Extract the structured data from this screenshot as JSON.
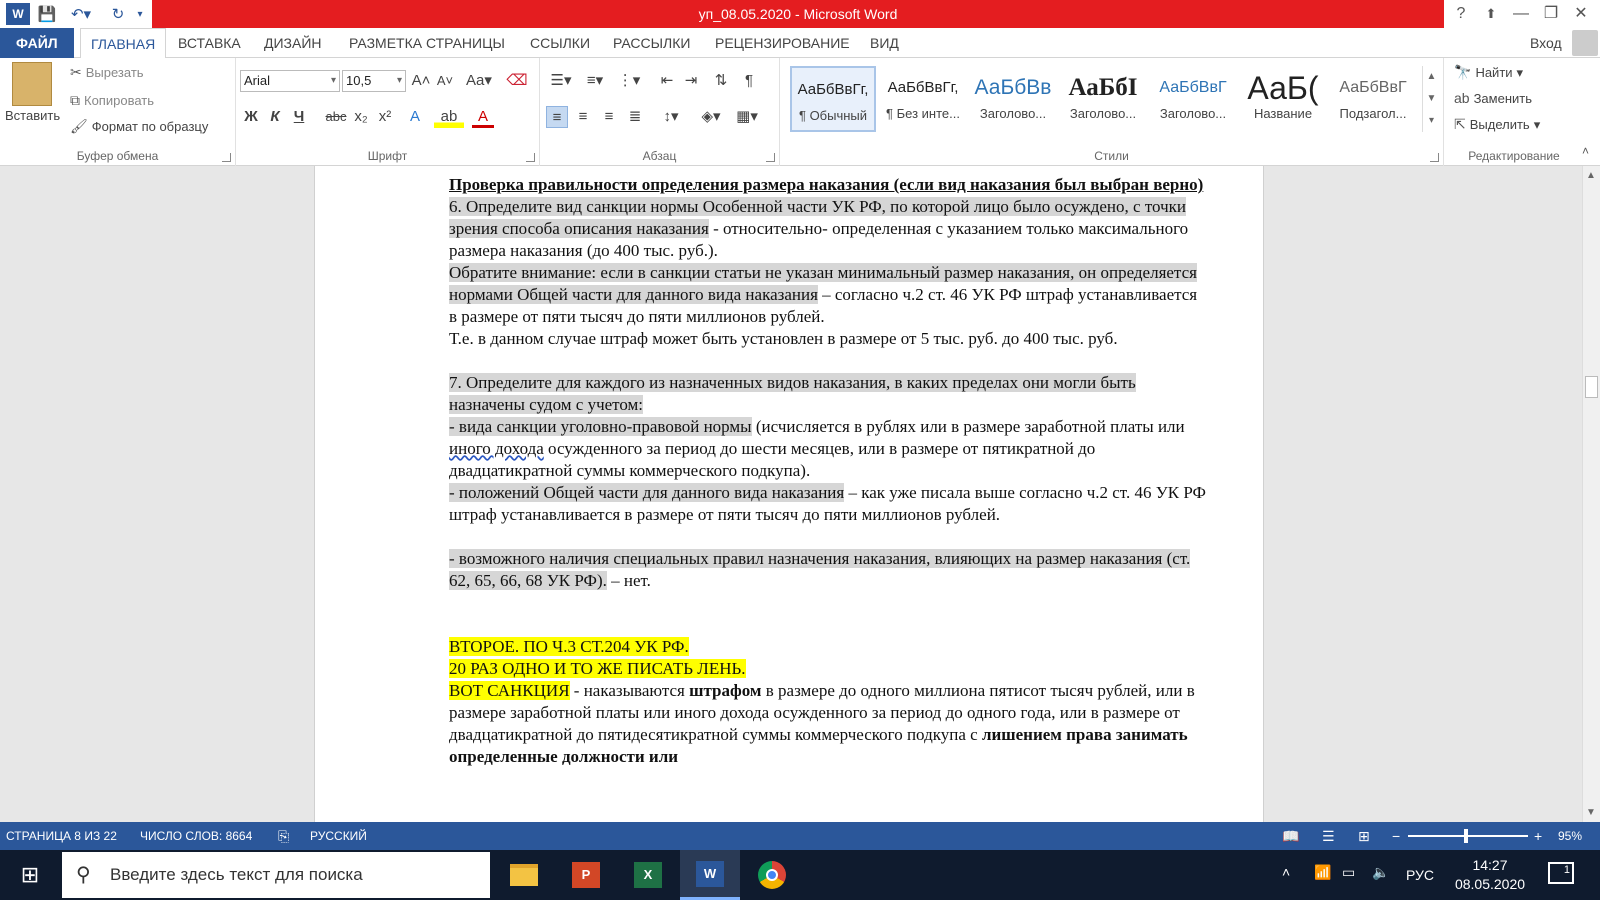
{
  "app": {
    "title": "уп_08.05.2020 - Microsoft Word"
  },
  "window": {
    "help": "?",
    "minimize": "—",
    "restore": "❐",
    "close": "✕"
  },
  "tabs": [
    "ФАЙЛ",
    "ГЛАВНАЯ",
    "ВСТАВКА",
    "ДИЗАЙН",
    "РАЗМЕТКА СТРАНИЦЫ",
    "ССЫЛКИ",
    "РАССЫЛКИ",
    "РЕЦЕНЗИРОВАНИЕ",
    "ВИД"
  ],
  "signin": "Вход",
  "clipboard": {
    "paste": "Вставить",
    "cut": "Вырезать",
    "copy": "Копировать",
    "format_painter": "Формат по образцу",
    "label": "Буфер обмена"
  },
  "font": {
    "name": "Arial",
    "size": "10,5",
    "label": "Шрифт",
    "bold": "Ж",
    "italic": "К",
    "underline": "Ч",
    "strike": "abc",
    "sub": "x₂",
    "sup": "x²"
  },
  "paragraph": {
    "label": "Абзац"
  },
  "styles": {
    "label": "Стили",
    "items": [
      {
        "preview": "АаБбВвГг,",
        "name": "¶ Обычный"
      },
      {
        "preview": "АаБбВвГг,",
        "name": "¶ Без инте..."
      },
      {
        "preview": "АаБбВв",
        "name": "Заголово..."
      },
      {
        "preview": "АаБбІ",
        "name": "Заголово..."
      },
      {
        "preview": "АаБбВвГ",
        "name": "Заголово..."
      },
      {
        "preview": "АаБ(",
        "name": "Название"
      },
      {
        "preview": "АаБбВвГ",
        "name": "Подзагол..."
      }
    ]
  },
  "editing": {
    "find": "Найти",
    "replace": "Заменить",
    "select": "Выделить",
    "label": "Редактирование"
  },
  "doc": {
    "p1": "Проверка правильности определения размера наказания (если вид наказания был выбран верно)",
    "p2a": "6. Определите вид санкции нормы Особенной части УК РФ, по которой лицо было осуждено, с точки зрения способа описания наказания",
    "p2b": " - относительно- определенная с указанием только максимального размера наказания (до 400 тыс. руб.).",
    "p3a": "Обратите внимание: если в санкции статьи не указан минимальный размер наказания, он определяется нормами Общей части для данного вида наказания",
    "p3b": " – согласно ч.2 ст. 46 УК РФ штраф устанавливается в размере от пяти тысяч до пяти миллионов рублей.",
    "p4": "Т.е. в данном случае штраф может быть установлен в размере от 5 тыс. руб. до 400 тыс. руб.",
    "p5": "7. Определите для каждого из назначенных видов наказания, в каких пределах они могли быть назначены судом с учетом:",
    "p6a": "- вида санкции уголовно-правовой нормы",
    "p6b": " (исчисляется в рублях или в размере заработной платы или ",
    "p6c": "иного дохода",
    "p6d": " осужденного за период до шести месяцев, или в размере от пятикратной до двадцатикратной суммы коммерческого подкупа).",
    "p7a": "- положений Общей части для данного вида наказания",
    "p7b": " – как уже писала выше согласно ч.2 ст. 46 УК РФ штраф устанавливается в размере от пяти тысяч до пяти миллионов рублей.",
    "p8a": "- возможного наличия специальных правил назначения наказания, влияющих на размер наказания (ст. 62, 65, 66, 68 УК РФ).",
    "p8b": " – нет.",
    "p9": "ВТОРОЕ. ПО Ч.3 СТ.204 УК РФ.",
    "p10": "20 РАЗ ОДНО И ТО ЖЕ ПИСАТЬ ЛЕНЬ.",
    "p11a": "ВОТ САНКЦИЯ",
    "p11b": " - наказываются ",
    "p11c": "штрафом",
    "p11d": " в размере до одного миллиона пятисот тысяч рублей, или в размере заработной платы или иного дохода осужденного за период до одного года, или в размере от двадцатикратной до пятидесятикратной суммы коммерческого подкупа с ",
    "p11e": "лишением права занимать определенные должности или"
  },
  "status": {
    "page": "СТРАНИЦА 8 ИЗ 22",
    "words": "ЧИСЛО СЛОВ: 8664",
    "lang": "РУССКИЙ",
    "zoom": "95%"
  },
  "taskbar": {
    "search": "Введите здесь текст для поиска",
    "lang": "РУС",
    "time": "14:27",
    "date": "08.05.2020",
    "notif": "1"
  }
}
